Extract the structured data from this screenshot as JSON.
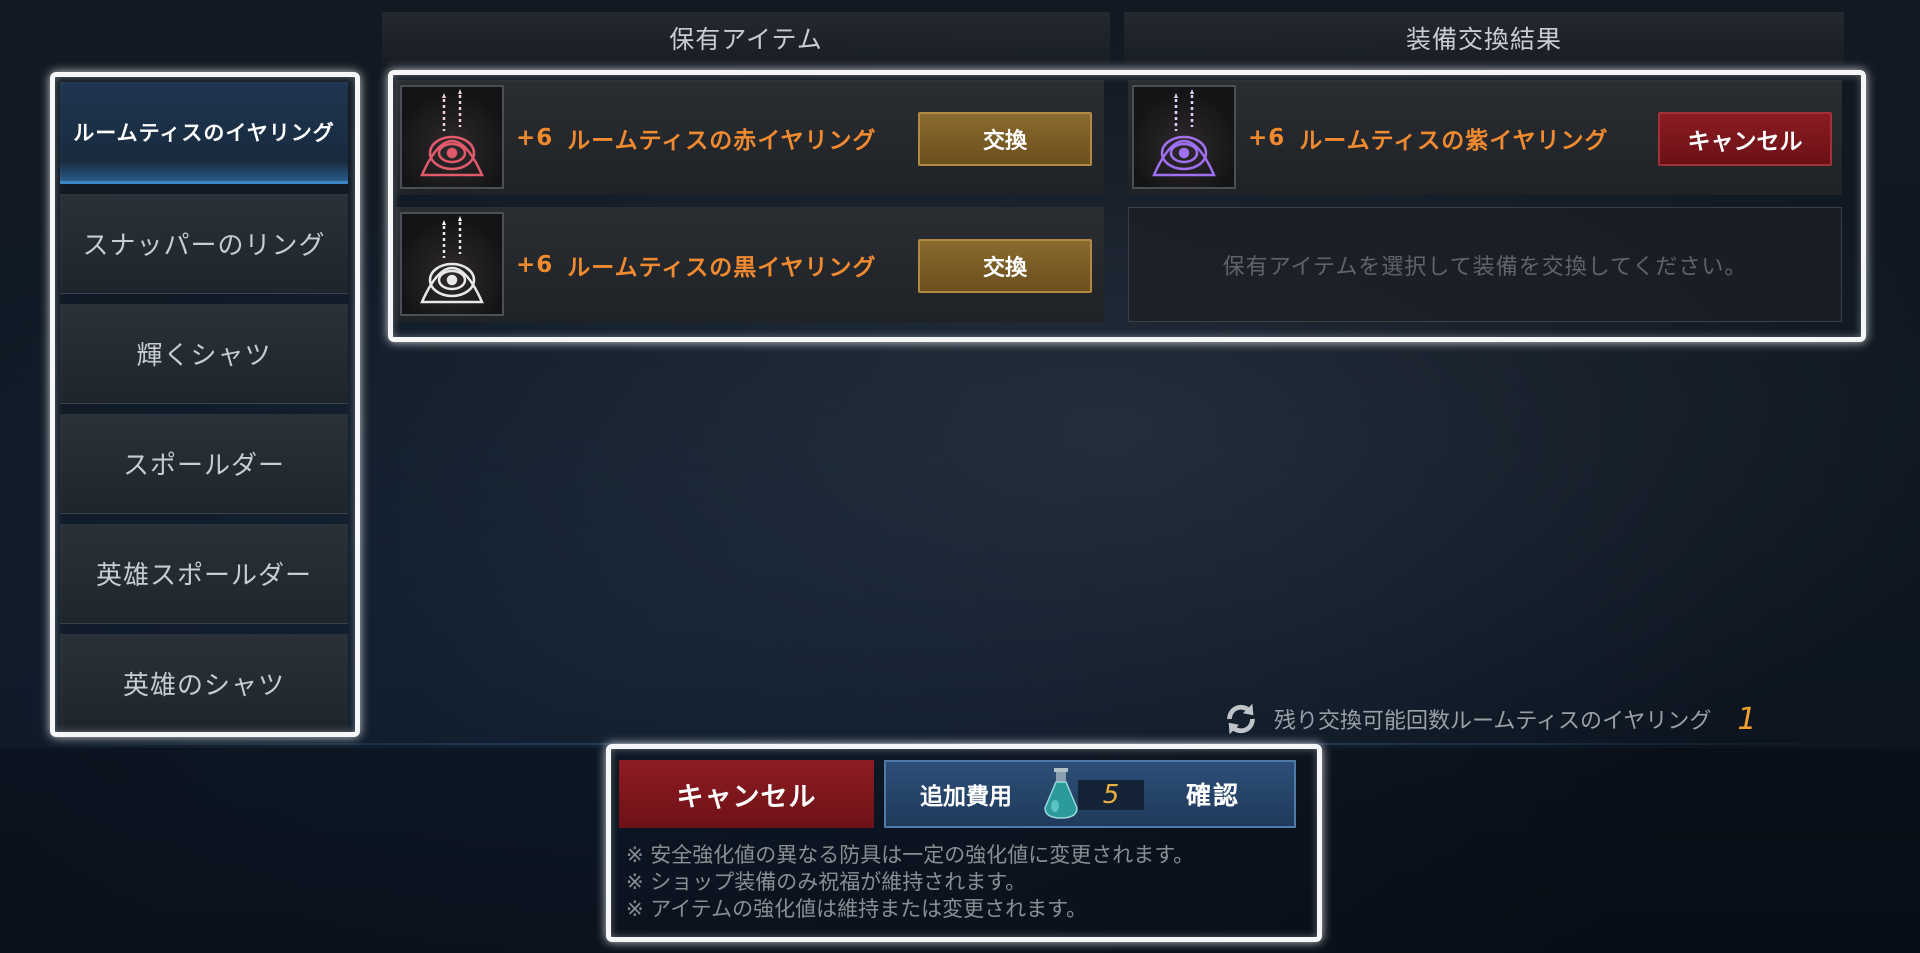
{
  "headers": {
    "owned_items": "保有アイテム",
    "exchange_result": "装備交換結果"
  },
  "sidebar": {
    "items": [
      {
        "label": "ルームティスのイヤリング",
        "active": true
      },
      {
        "label": "スナッパーのリング"
      },
      {
        "label": "輝くシャツ"
      },
      {
        "label": "スポールダー"
      },
      {
        "label": "英雄スポールダー"
      },
      {
        "label": "英雄のシャツ"
      }
    ]
  },
  "owned_items": [
    {
      "plus": "+6",
      "name": "ルームティスの赤イヤリング",
      "button": "交換",
      "color": "#e05a6a"
    },
    {
      "plus": "+6",
      "name": "ルームティスの黒イヤリング",
      "button": "交換",
      "color": "#e8e8e8"
    }
  ],
  "result_items": [
    {
      "plus": "+6",
      "name": "ルームティスの紫イヤリング",
      "button": "キャンセル",
      "color": "#a070f0"
    }
  ],
  "result_empty_message": "保有アイテムを選択して装備を交換してください。",
  "remaining": {
    "label": "残り交換可能回数ルームティスのイヤリング",
    "count": "1"
  },
  "bottom": {
    "cancel_label": "キャンセル",
    "fee_label": "追加費用",
    "fee_value": "5",
    "confirm_label": "確認"
  },
  "notes": [
    "※  安全強化値の異なる防具は一定の強化値に変更されます。",
    "※  ショップ装備のみ祝福が維持されます。",
    "※  アイテムの強化値は維持または変更されます。"
  ],
  "colors": {
    "accent_orange": "#f08a30",
    "exchange_gold": "#8a6a2e",
    "cancel_red": "#8b1c22",
    "confirm_blue": "#2d4f78"
  }
}
